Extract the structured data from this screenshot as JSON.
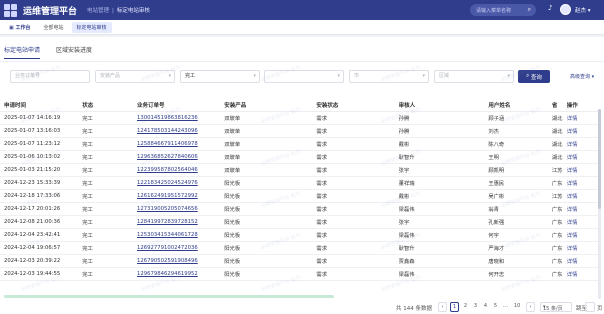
{
  "header": {
    "app_title": "运维管理平台",
    "crumb_parent": "电站管理",
    "crumb_current": "标定电站审核",
    "search_placeholder": "请输入菜单名称",
    "user_name": "赵杰"
  },
  "tabs": {
    "home": "工作台",
    "items": [
      "全部电站",
      "标定电站审核"
    ]
  },
  "subtabs": [
    "标定电站申请",
    "区域安装进度"
  ],
  "filters": {
    "order_placeholder": "业务订单号",
    "product_placeholder": "安装产品",
    "status_value": "完工",
    "f4": "",
    "f5": "市",
    "f6": "区域",
    "query_label": "查询",
    "advanced_label": "高级查询"
  },
  "table": {
    "headers": [
      "申请时间",
      "状态",
      "业务订单号",
      "安装产品",
      "安装状态",
      "审核人",
      "用户姓名",
      "省",
      "操作"
    ],
    "rows": [
      [
        "2025-01-07 14:16:19",
        "完工",
        "130014519863816236",
        "双玻单",
        "需求",
        "孙腾",
        "顾子涵",
        "湖北",
        "详情"
      ],
      [
        "2025-01-07 13:16:03",
        "完工",
        "124178503144243096",
        "双玻单",
        "需求",
        "孙腾",
        "刘杰",
        "湖北",
        "详情"
      ],
      [
        "2025-01-07 11:23:12",
        "完工",
        "125884667911406978",
        "双玻单",
        "需求",
        "戴彬",
        "陈八奇",
        "湖北",
        "详情"
      ],
      [
        "2025-01-06 10:13:02",
        "完工",
        "129636852627840606",
        "双玻单",
        "需求",
        "耿智升",
        "王明",
        "湖北",
        "详情"
      ],
      [
        "2025-01-03 21:15:20",
        "完工",
        "122399587802564046",
        "双玻单",
        "需求",
        "张宇",
        "顾凯明",
        "江苏",
        "详情"
      ],
      [
        "2024-12-23 15:33:39",
        "完工",
        "122183425024524976",
        "阳光板",
        "需求",
        "董祥瑞",
        "王惠民",
        "广东",
        "详情"
      ],
      [
        "2024-12-18 17:33:06",
        "完工",
        "126162491951572992",
        "阳光板",
        "需求",
        "戴彬",
        "吴广彬",
        "江苏",
        "详情"
      ],
      [
        "2024-12-17 20:01:26",
        "完工",
        "127319005205074656",
        "阳光板",
        "需求",
        "梁磊伟",
        "翁青",
        "广东",
        "详情"
      ],
      [
        "2024-12-08 21:00:36",
        "完工",
        "128419972839728152",
        "阳光板",
        "需求",
        "张宇",
        "孔新强",
        "广东",
        "详情"
      ],
      [
        "2024-12-04 23:42:41",
        "完工",
        "125303415344061728",
        "阳光板",
        "需求",
        "梁磊伟",
        "何宇",
        "广东",
        "详情"
      ],
      [
        "2024-12-04 19:06:57",
        "完工",
        "126927791002472036",
        "阳光板",
        "需求",
        "耿智升",
        "严海才",
        "广东",
        "详情"
      ],
      [
        "2024-12-03 20:39:22",
        "完工",
        "126790502591908496",
        "阳光板",
        "需求",
        "贾鑫森",
        "唐晓和",
        "广东",
        "详情"
      ],
      [
        "2024-12-03 19:44:55",
        "完工",
        "129679846294619952",
        "阳光板",
        "需求",
        "梁磊伟",
        "何开志",
        "广东",
        "详情"
      ]
    ]
  },
  "pager": {
    "total": "共 144 条数据",
    "pages": [
      "1",
      "2",
      "3",
      "4",
      "5",
      "…",
      "10"
    ],
    "page_size": "15 条/页",
    "goto_label": "跳至",
    "page_suffix": "页"
  },
  "watermark": "运维管理平台 赵杰"
}
